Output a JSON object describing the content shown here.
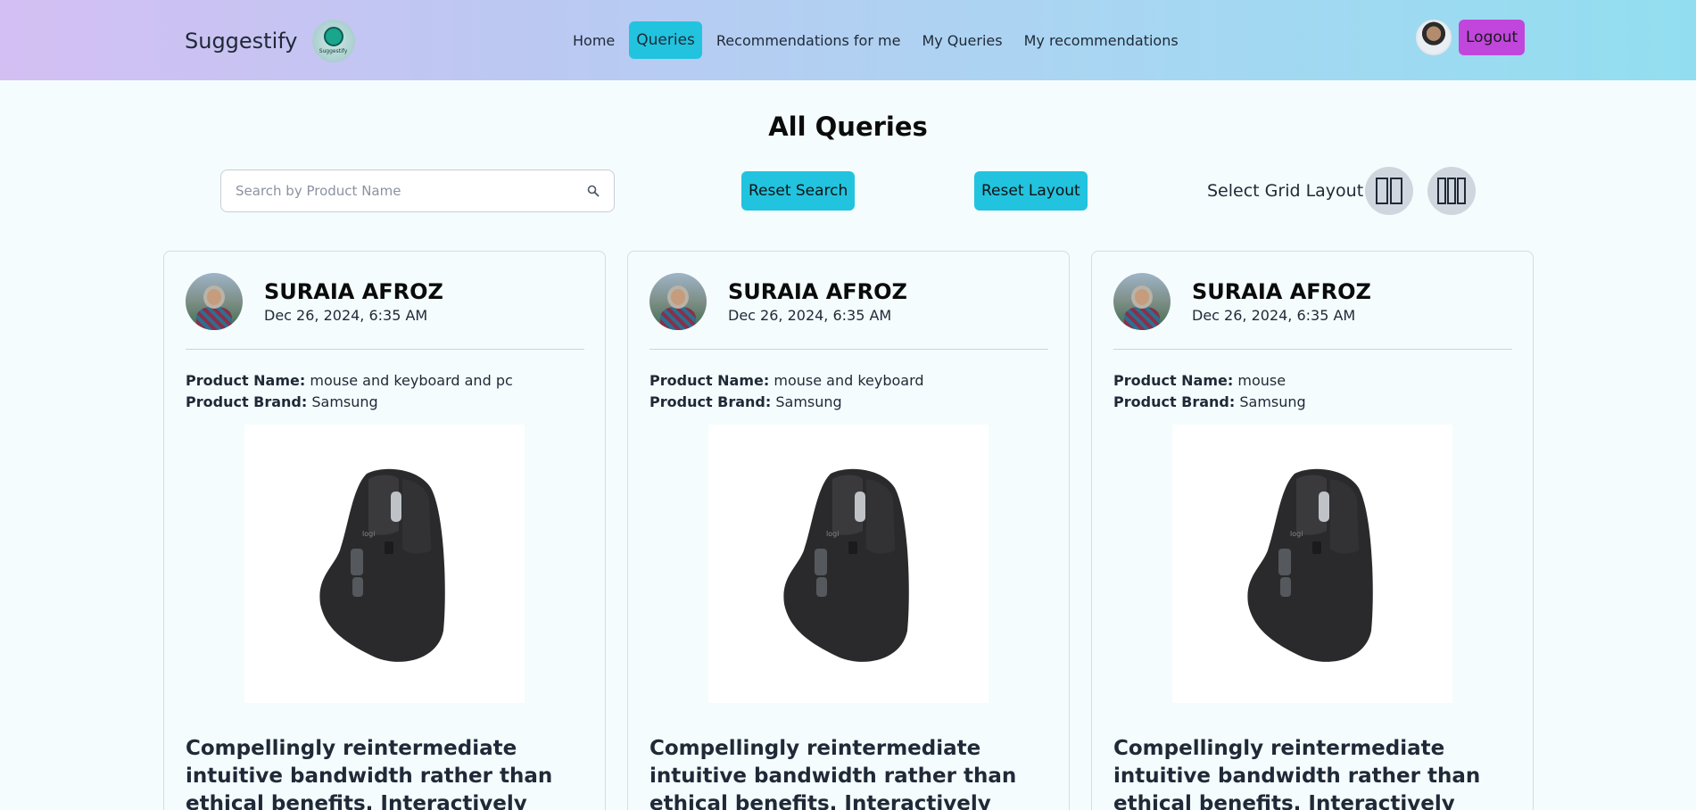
{
  "navbar": {
    "brand_name": "Suggestify",
    "brand_logo_text": "Suggestify",
    "links": [
      {
        "label": "Home",
        "active": false
      },
      {
        "label": "Queries",
        "active": true
      },
      {
        "label": "Recommendations for me",
        "active": false
      },
      {
        "label": "My Queries",
        "active": false
      },
      {
        "label": "My recommendations",
        "active": false
      }
    ],
    "logout_label": "Logout",
    "colors": {
      "active_link": "#22c3de",
      "logout": "#c146dc"
    }
  },
  "page": {
    "title": "All Queries"
  },
  "controls": {
    "search_placeholder": "Search by Product Name",
    "search_value": "",
    "reset_search_label": "Reset Search",
    "reset_layout_label": "Reset Layout",
    "grid_layout_label": "Select Grid Layout",
    "grid_options": [
      "two-column-icon",
      "three-column-icon"
    ]
  },
  "cards": [
    {
      "user_name": "SURAIA AFROZ",
      "date": "Dec 26, 2024, 6:35 AM",
      "product_name_label": "Product Name:",
      "product_name": "mouse and keyboard and pc",
      "product_brand_label": "Product Brand:",
      "product_brand": "Samsung",
      "description": "Compellingly reintermediate intuitive bandwidth rather than ethical benefits. Interactively initiate extensive"
    },
    {
      "user_name": "SURAIA AFROZ",
      "date": "Dec 26, 2024, 6:35 AM",
      "product_name_label": "Product Name:",
      "product_name": "mouse and keyboard",
      "product_brand_label": "Product Brand:",
      "product_brand": "Samsung",
      "description": "Compellingly reintermediate intuitive bandwidth rather than ethical benefits. Interactively initiate extensive"
    },
    {
      "user_name": "SURAIA AFROZ",
      "date": "Dec 26, 2024, 6:35 AM",
      "product_name_label": "Product Name:",
      "product_name": "mouse",
      "product_brand_label": "Product Brand:",
      "product_brand": "Samsung",
      "description": "Compellingly reintermediate intuitive bandwidth rather than ethical benefits. Interactively initiate extensive"
    }
  ]
}
